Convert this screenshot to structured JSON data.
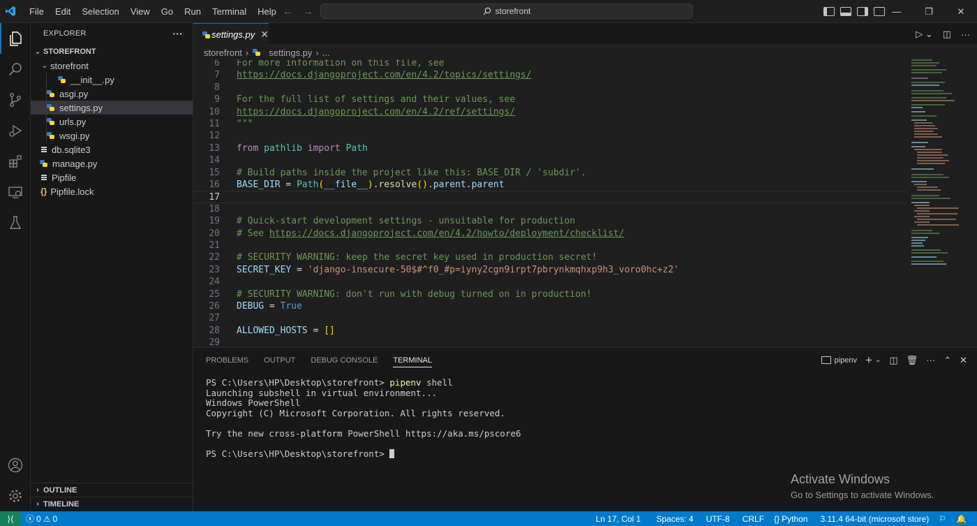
{
  "titlebar": {
    "menu": [
      "File",
      "Edit",
      "Selection",
      "View",
      "Go",
      "Run",
      "Terminal",
      "Help"
    ],
    "command_center": "storefront"
  },
  "sidebar": {
    "header": "EXPLORER",
    "more": "···",
    "root": "STOREFRONT",
    "folder": "storefront",
    "files": [
      {
        "name": "__init__.py"
      },
      {
        "name": "asgi.py"
      },
      {
        "name": "settings.py"
      },
      {
        "name": "urls.py"
      },
      {
        "name": "wsgi.py"
      }
    ],
    "root_files": [
      {
        "name": "db.sqlite3"
      },
      {
        "name": "manage.py"
      },
      {
        "name": "Pipfile"
      },
      {
        "name": "Pipfile.lock"
      }
    ],
    "outline": "OUTLINE",
    "timeline": "TIMELINE"
  },
  "editor": {
    "tab": "settings.py",
    "breadcrumb": [
      "storefront",
      "settings.py",
      "..."
    ],
    "line_numbers": [
      "6",
      "7",
      "8",
      "9",
      "10",
      "11",
      "12",
      "13",
      "14",
      "15",
      "16",
      "17",
      "18",
      "19",
      "20",
      "21",
      "22",
      "23",
      "24",
      "25",
      "26",
      "27",
      "28",
      "29"
    ],
    "code": {
      "l6": "For more information on this file, see",
      "l7": "https://docs.djangoproject.com/en/4.2/topics/settings/",
      "l9": "For the full list of settings and their values, see",
      "l10": "https://docs.djangoproject.com/en/4.2/ref/settings/",
      "l11": "\"\"\"",
      "l13_from": "from",
      "l13_mod": "pathlib",
      "l13_import": "import",
      "l13_name": "Path",
      "l15": "# Build paths inside the project like this: BASE_DIR / 'subdir'.",
      "l16_var": "BASE_DIR",
      "l16_eq": " = ",
      "l16_cls": "Path",
      "l16_p1": "(",
      "l16_file": "__file__",
      "l16_p2": ")",
      "l16_dot1": ".",
      "l16_fn": "resolve",
      "l16_p3": "()",
      "l16_rest": ".parent.parent",
      "l19": "# Quick-start development settings - unsuitable for production",
      "l20_a": "# See ",
      "l20_link": "https://docs.djangoproject.com/en/4.2/howto/deployment/checklist/",
      "l22": "# SECURITY WARNING: keep the secret key used in production secret!",
      "l23_var": "SECRET_KEY",
      "l23_eq": " = ",
      "l23_str": "'django-insecure-50$#^f0_#p=iyny2cgn9irpt7pbrynkmqhxp9h3_voro0hc+z2'",
      "l25": "# SECURITY WARNING: don't run with debug turned on in production!",
      "l26_var": "DEBUG",
      "l26_eq": " = ",
      "l26_val": "True",
      "l28_var": "ALLOWED_HOSTS",
      "l28_eq": " = ",
      "l28_val": "[]"
    }
  },
  "panel": {
    "tabs": [
      "PROBLEMS",
      "OUTPUT",
      "DEBUG CONSOLE",
      "TERMINAL"
    ],
    "terminal_name": "pipenv",
    "terminal": {
      "prompt": "PS C:\\Users\\HP\\Desktop\\storefront> ",
      "cmd1": "pipenv",
      "cmd1_rest": " shell",
      "line2": "Launching subshell in virtual environment...",
      "line3": "Windows PowerShell",
      "line4": "Copyright (C) Microsoft Corporation. All rights reserved.",
      "line6": "Try the new cross-platform PowerShell https://aka.ms/pscore6"
    }
  },
  "watermark": {
    "title": "Activate Windows",
    "subtitle": "Go to Settings to activate Windows."
  },
  "statusbar": {
    "errors": "0",
    "warnings": "0",
    "position": "Ln 17, Col 1",
    "spaces": "Spaces: 4",
    "encoding": "UTF-8",
    "eol": "CRLF",
    "language": "Python",
    "interpreter": "3.11.4 64-bit (microsoft store)"
  },
  "colors": {
    "accent": "#0078d4",
    "statusbar": "#007acc",
    "remote": "#16825d"
  }
}
